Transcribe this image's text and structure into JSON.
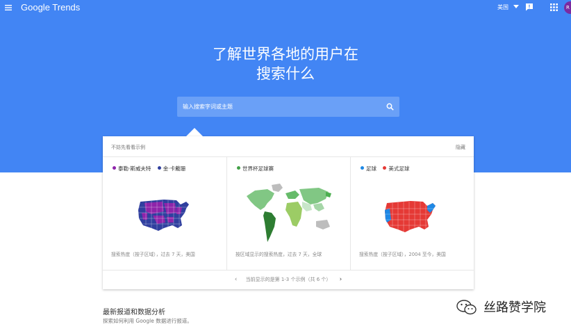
{
  "topbar": {
    "logo": "Google Trends",
    "country": "美国",
    "avatar_initial": "R"
  },
  "hero": {
    "title_line1": "了解世界各地的用户在",
    "title_line2": "搜索什么"
  },
  "search": {
    "placeholder": "输入搜索字词或主题"
  },
  "examples": {
    "header_label": "不妨先看看示例",
    "hide_label": "隐藏",
    "panels": [
      {
        "legend": [
          {
            "label": "泰勒·斯威夫特",
            "color": "#8e24aa"
          },
          {
            "label": "金·卡戴珊",
            "color": "#303f9f"
          }
        ],
        "caption": "搜索热度（按子区域），过去 7 天，美国"
      },
      {
        "legend": [
          {
            "label": "世界杯足球赛",
            "color": "#43a047"
          }
        ],
        "caption": "按区域显示的搜索热度，过去 7 天，全球"
      },
      {
        "legend": [
          {
            "label": "足球",
            "color": "#1e88e5"
          },
          {
            "label": "美式足球",
            "color": "#e53935"
          }
        ],
        "caption": "搜索热度（按子区域），2004 至今，美国"
      }
    ],
    "pager_text": "当前显示的是第 1-3 个示例（共 6 个）",
    "prev_symbol": "‹",
    "next_symbol": "›"
  },
  "news": {
    "title": "最新报道和数据分析",
    "subtitle": "探索如何利用 Google 数据进行报道。"
  },
  "watermark": {
    "text": "丝路赞学院"
  },
  "colors": {
    "hero_blue": "#4285f4",
    "purple": "#8e24aa",
    "indigo": "#303f9f",
    "green": "#43a047",
    "dark_green": "#2e7d32",
    "blue": "#1e88e5",
    "red": "#e53935"
  }
}
